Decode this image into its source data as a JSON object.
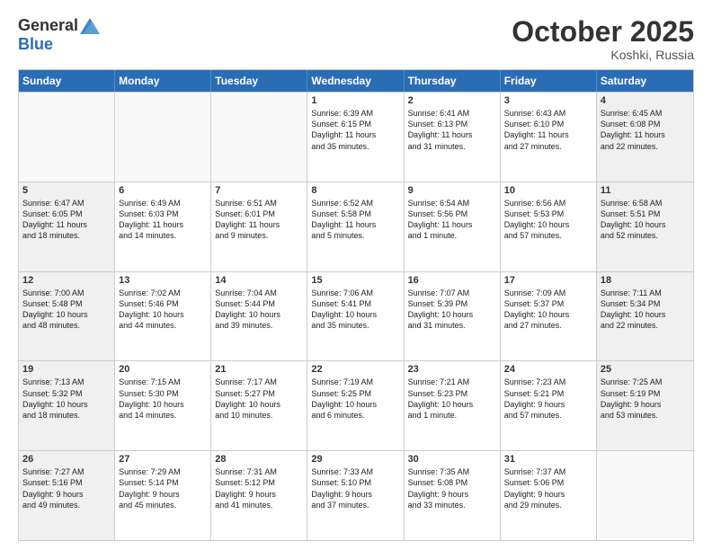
{
  "logo": {
    "general": "General",
    "blue": "Blue"
  },
  "title": "October 2025",
  "location": "Koshki, Russia",
  "days": [
    "Sunday",
    "Monday",
    "Tuesday",
    "Wednesday",
    "Thursday",
    "Friday",
    "Saturday"
  ],
  "rows": [
    [
      {
        "day": "",
        "text": "",
        "empty": true
      },
      {
        "day": "",
        "text": "",
        "empty": true
      },
      {
        "day": "",
        "text": "",
        "empty": true
      },
      {
        "day": "1",
        "text": "Sunrise: 6:39 AM\nSunset: 6:15 PM\nDaylight: 11 hours\nand 35 minutes.",
        "empty": false
      },
      {
        "day": "2",
        "text": "Sunrise: 6:41 AM\nSunset: 6:13 PM\nDaylight: 11 hours\nand 31 minutes.",
        "empty": false
      },
      {
        "day": "3",
        "text": "Sunrise: 6:43 AM\nSunset: 6:10 PM\nDaylight: 11 hours\nand 27 minutes.",
        "empty": false
      },
      {
        "day": "4",
        "text": "Sunrise: 6:45 AM\nSunset: 6:08 PM\nDaylight: 11 hours\nand 22 minutes.",
        "empty": false,
        "shaded": true
      }
    ],
    [
      {
        "day": "5",
        "text": "Sunrise: 6:47 AM\nSunset: 6:05 PM\nDaylight: 11 hours\nand 18 minutes.",
        "empty": false,
        "shaded": true
      },
      {
        "day": "6",
        "text": "Sunrise: 6:49 AM\nSunset: 6:03 PM\nDaylight: 11 hours\nand 14 minutes.",
        "empty": false
      },
      {
        "day": "7",
        "text": "Sunrise: 6:51 AM\nSunset: 6:01 PM\nDaylight: 11 hours\nand 9 minutes.",
        "empty": false
      },
      {
        "day": "8",
        "text": "Sunrise: 6:52 AM\nSunset: 5:58 PM\nDaylight: 11 hours\nand 5 minutes.",
        "empty": false
      },
      {
        "day": "9",
        "text": "Sunrise: 6:54 AM\nSunset: 5:56 PM\nDaylight: 11 hours\nand 1 minute.",
        "empty": false
      },
      {
        "day": "10",
        "text": "Sunrise: 6:56 AM\nSunset: 5:53 PM\nDaylight: 10 hours\nand 57 minutes.",
        "empty": false
      },
      {
        "day": "11",
        "text": "Sunrise: 6:58 AM\nSunset: 5:51 PM\nDaylight: 10 hours\nand 52 minutes.",
        "empty": false,
        "shaded": true
      }
    ],
    [
      {
        "day": "12",
        "text": "Sunrise: 7:00 AM\nSunset: 5:48 PM\nDaylight: 10 hours\nand 48 minutes.",
        "empty": false,
        "shaded": true
      },
      {
        "day": "13",
        "text": "Sunrise: 7:02 AM\nSunset: 5:46 PM\nDaylight: 10 hours\nand 44 minutes.",
        "empty": false
      },
      {
        "day": "14",
        "text": "Sunrise: 7:04 AM\nSunset: 5:44 PM\nDaylight: 10 hours\nand 39 minutes.",
        "empty": false
      },
      {
        "day": "15",
        "text": "Sunrise: 7:06 AM\nSunset: 5:41 PM\nDaylight: 10 hours\nand 35 minutes.",
        "empty": false
      },
      {
        "day": "16",
        "text": "Sunrise: 7:07 AM\nSunset: 5:39 PM\nDaylight: 10 hours\nand 31 minutes.",
        "empty": false
      },
      {
        "day": "17",
        "text": "Sunrise: 7:09 AM\nSunset: 5:37 PM\nDaylight: 10 hours\nand 27 minutes.",
        "empty": false
      },
      {
        "day": "18",
        "text": "Sunrise: 7:11 AM\nSunset: 5:34 PM\nDaylight: 10 hours\nand 22 minutes.",
        "empty": false,
        "shaded": true
      }
    ],
    [
      {
        "day": "19",
        "text": "Sunrise: 7:13 AM\nSunset: 5:32 PM\nDaylight: 10 hours\nand 18 minutes.",
        "empty": false,
        "shaded": true
      },
      {
        "day": "20",
        "text": "Sunrise: 7:15 AM\nSunset: 5:30 PM\nDaylight: 10 hours\nand 14 minutes.",
        "empty": false
      },
      {
        "day": "21",
        "text": "Sunrise: 7:17 AM\nSunset: 5:27 PM\nDaylight: 10 hours\nand 10 minutes.",
        "empty": false
      },
      {
        "day": "22",
        "text": "Sunrise: 7:19 AM\nSunset: 5:25 PM\nDaylight: 10 hours\nand 6 minutes.",
        "empty": false
      },
      {
        "day": "23",
        "text": "Sunrise: 7:21 AM\nSunset: 5:23 PM\nDaylight: 10 hours\nand 1 minute.",
        "empty": false
      },
      {
        "day": "24",
        "text": "Sunrise: 7:23 AM\nSunset: 5:21 PM\nDaylight: 9 hours\nand 57 minutes.",
        "empty": false
      },
      {
        "day": "25",
        "text": "Sunrise: 7:25 AM\nSunset: 5:19 PM\nDaylight: 9 hours\nand 53 minutes.",
        "empty": false,
        "shaded": true
      }
    ],
    [
      {
        "day": "26",
        "text": "Sunrise: 7:27 AM\nSunset: 5:16 PM\nDaylight: 9 hours\nand 49 minutes.",
        "empty": false,
        "shaded": true
      },
      {
        "day": "27",
        "text": "Sunrise: 7:29 AM\nSunset: 5:14 PM\nDaylight: 9 hours\nand 45 minutes.",
        "empty": false
      },
      {
        "day": "28",
        "text": "Sunrise: 7:31 AM\nSunset: 5:12 PM\nDaylight: 9 hours\nand 41 minutes.",
        "empty": false
      },
      {
        "day": "29",
        "text": "Sunrise: 7:33 AM\nSunset: 5:10 PM\nDaylight: 9 hours\nand 37 minutes.",
        "empty": false
      },
      {
        "day": "30",
        "text": "Sunrise: 7:35 AM\nSunset: 5:08 PM\nDaylight: 9 hours\nand 33 minutes.",
        "empty": false
      },
      {
        "day": "31",
        "text": "Sunrise: 7:37 AM\nSunset: 5:06 PM\nDaylight: 9 hours\nand 29 minutes.",
        "empty": false
      },
      {
        "day": "",
        "text": "",
        "empty": true,
        "shaded": true
      }
    ]
  ]
}
